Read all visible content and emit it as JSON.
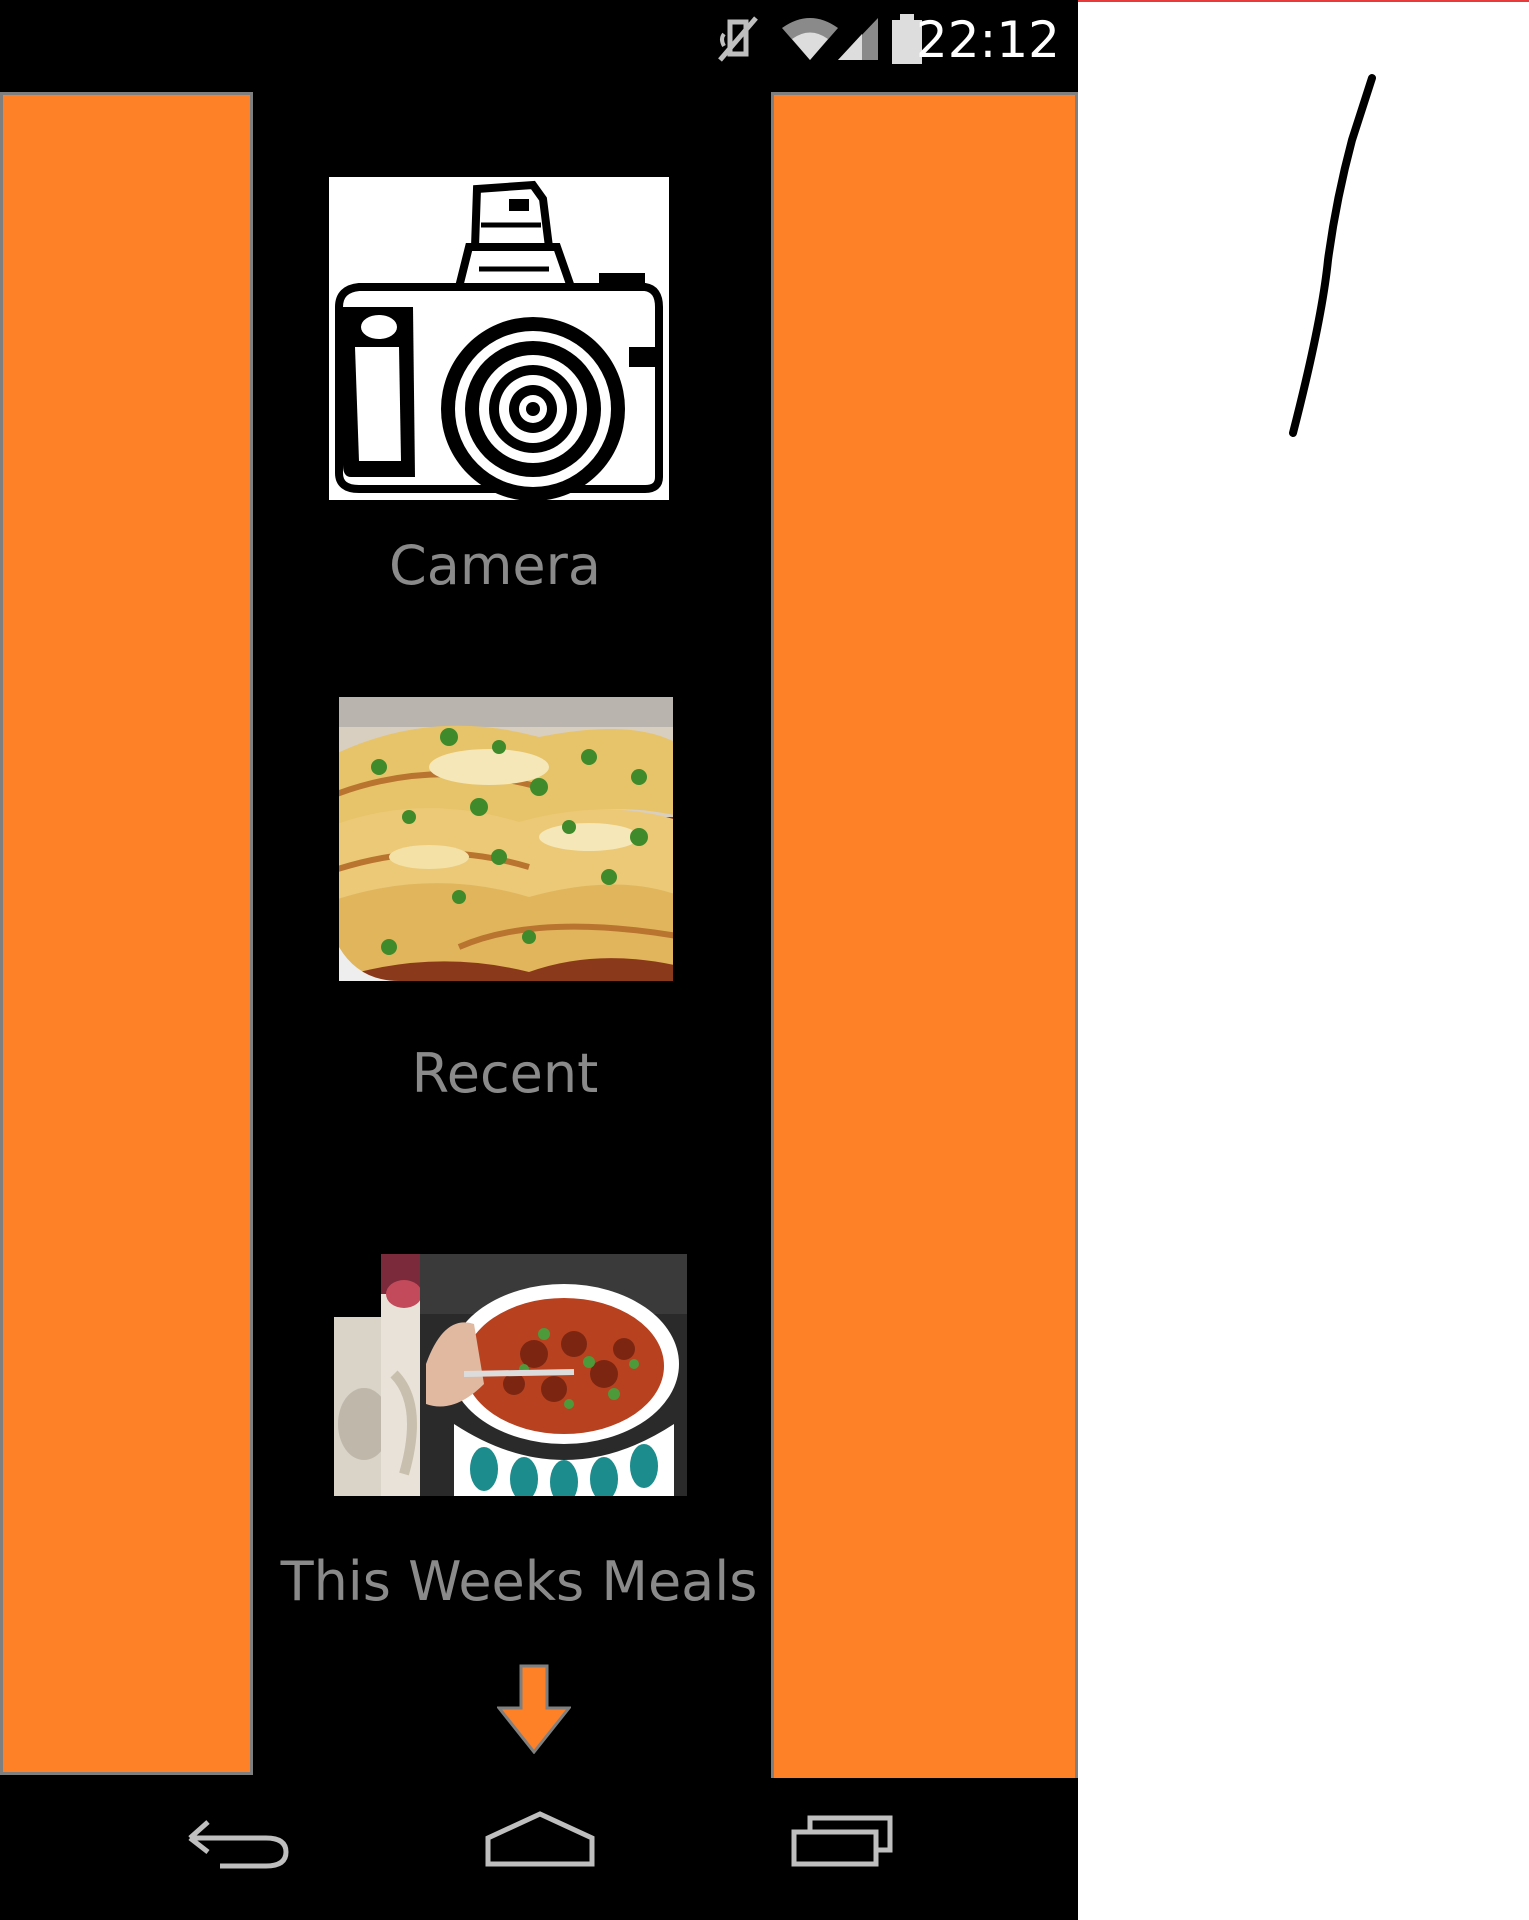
{
  "status_bar": {
    "time": "22:12",
    "icons": [
      "mute-icon",
      "wifi-icon",
      "signal-icon",
      "battery-icon"
    ]
  },
  "menu": {
    "items": [
      {
        "label": "Camera",
        "icon": "camera-icon"
      },
      {
        "label": "Recent",
        "icon": "enchiladas-photo"
      },
      {
        "label": "This Weeks Meals",
        "icon": "meals-stack-photo"
      }
    ],
    "scroll_hint": "arrow-down-icon"
  },
  "nav_bar": {
    "buttons": [
      "back-icon",
      "home-icon",
      "recents-icon"
    ]
  },
  "colors": {
    "accent": "#fe8027",
    "panel_border": "#7f7f7f",
    "label_text": "#8a8a8a",
    "background": "#000000",
    "status_text": "#ffffff"
  }
}
